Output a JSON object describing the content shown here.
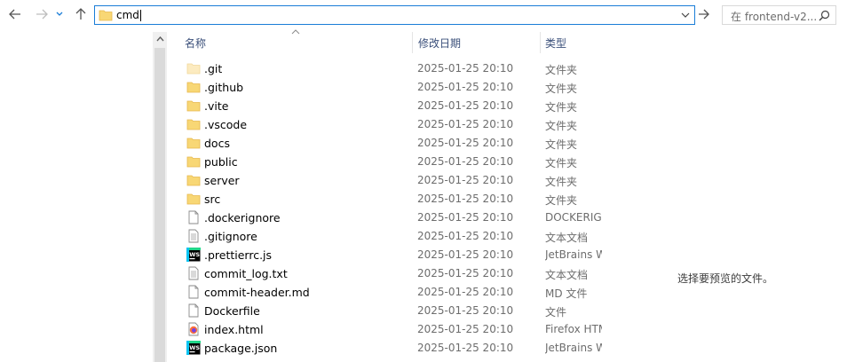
{
  "address": {
    "value": "cmd"
  },
  "search": {
    "placeholder": "在 frontend-v2..."
  },
  "columns": {
    "name": "名称",
    "date": "修改日期",
    "type": "类型"
  },
  "files": [
    {
      "name": ".git",
      "date": "2025-01-25 20:10",
      "type": "文件夹",
      "icon": "folder-light"
    },
    {
      "name": ".github",
      "date": "2025-01-25 20:10",
      "type": "文件夹",
      "icon": "folder"
    },
    {
      "name": ".vite",
      "date": "2025-01-25 20:10",
      "type": "文件夹",
      "icon": "folder"
    },
    {
      "name": ".vscode",
      "date": "2025-01-25 20:10",
      "type": "文件夹",
      "icon": "folder"
    },
    {
      "name": "docs",
      "date": "2025-01-25 20:10",
      "type": "文件夹",
      "icon": "folder"
    },
    {
      "name": "public",
      "date": "2025-01-25 20:10",
      "type": "文件夹",
      "icon": "folder"
    },
    {
      "name": "server",
      "date": "2025-01-25 20:10",
      "type": "文件夹",
      "icon": "folder"
    },
    {
      "name": "src",
      "date": "2025-01-25 20:10",
      "type": "文件夹",
      "icon": "folder"
    },
    {
      "name": ".dockerignore",
      "date": "2025-01-25 20:10",
      "type": "DOCKERIGNORE",
      "icon": "file-blank"
    },
    {
      "name": ".gitignore",
      "date": "2025-01-25 20:10",
      "type": "文本文档",
      "icon": "file-text"
    },
    {
      "name": ".prettierrc.js",
      "date": "2025-01-25 20:10",
      "type": "JetBrains WebStorm",
      "icon": "webstorm"
    },
    {
      "name": "commit_log.txt",
      "date": "2025-01-25 20:10",
      "type": "文本文档",
      "icon": "file-text"
    },
    {
      "name": "commit-header.md",
      "date": "2025-01-25 20:10",
      "type": "MD 文件",
      "icon": "file-blank"
    },
    {
      "name": "Dockerfile",
      "date": "2025-01-25 20:10",
      "type": "文件",
      "icon": "file-blank"
    },
    {
      "name": "index.html",
      "date": "2025-01-25 20:10",
      "type": "Firefox HTML",
      "icon": "firefox"
    },
    {
      "name": "package.json",
      "date": "2025-01-25 20:10",
      "type": "JetBrains WebStorm",
      "icon": "webstorm"
    }
  ],
  "preview": {
    "message": "选择要预览的文件。"
  },
  "icons": {
    "webstorm_label": "WS"
  },
  "colors": {
    "accent": "#1a7dd7",
    "folder": "#f8d775",
    "folder_dark": "#e6b84c"
  }
}
